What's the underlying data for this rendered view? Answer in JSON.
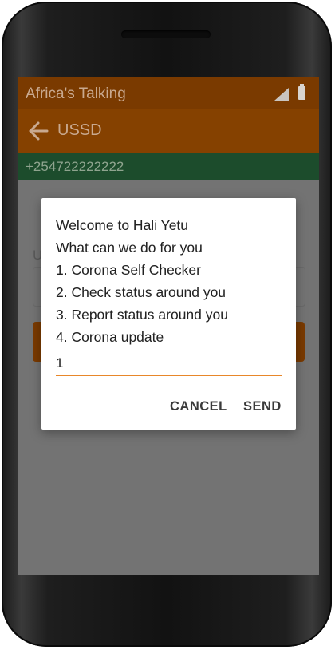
{
  "status_bar": {
    "app_name": "Africa's Talking",
    "icons": [
      "signal-icon",
      "battery-icon"
    ]
  },
  "app_bar": {
    "title": "USSD",
    "back_icon": "arrow-left-icon"
  },
  "phone_bar": {
    "number": "+254722222222"
  },
  "background_form": {
    "label_fragment": "U"
  },
  "dialog": {
    "lines": [
      "Welcome to Hali Yetu",
      "What can we do for you",
      "1. Corona Self Checker",
      "2. Check status around you",
      "3. Report status around you",
      "4. Corona update"
    ],
    "input_value": "1",
    "cancel_label": "CANCEL",
    "send_label": "SEND"
  },
  "colors": {
    "status_bar": "#7a3a00",
    "app_bar": "#854100",
    "phone_bar": "#1c4c2c",
    "accent": "#e8872a",
    "overlay": "#737373"
  }
}
